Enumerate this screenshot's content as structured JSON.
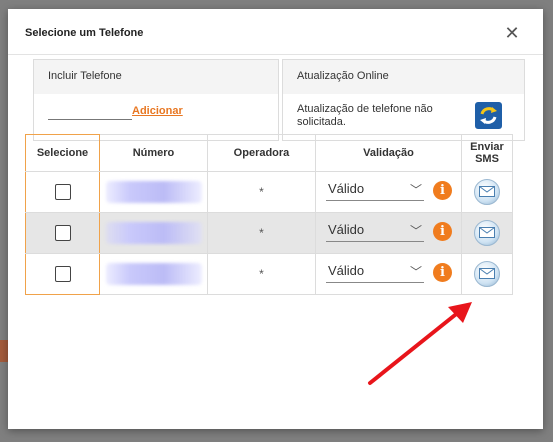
{
  "dialog": {
    "title": "Selecione um Telefone",
    "close_glyph": "✕"
  },
  "include_panel": {
    "title": "Incluir Telefone",
    "input_value": "",
    "add_label": "Adicionar"
  },
  "online_panel": {
    "title": "Atualização Online",
    "status_text": "Atualização de telefone não solicitada.",
    "icon": "refresh-icon"
  },
  "table": {
    "headers": {
      "select": "Selecione",
      "number": "Número",
      "operator": "Operadora",
      "validation": "Validação",
      "sms": "Enviar SMS"
    },
    "rows": [
      {
        "checked": false,
        "number": "",
        "operator": "*",
        "validation": "Válido"
      },
      {
        "checked": false,
        "number": "",
        "operator": "*",
        "validation": "Válido"
      },
      {
        "checked": false,
        "number": "",
        "operator": "*",
        "validation": "Válido"
      }
    ]
  },
  "icons": {
    "info": "info-icon",
    "sms": "envelope-icon",
    "chevron": "chevron-down-icon"
  },
  "colors": {
    "accent": "#e87722",
    "info": "#f07c1e",
    "arrow": "#e8151b"
  }
}
